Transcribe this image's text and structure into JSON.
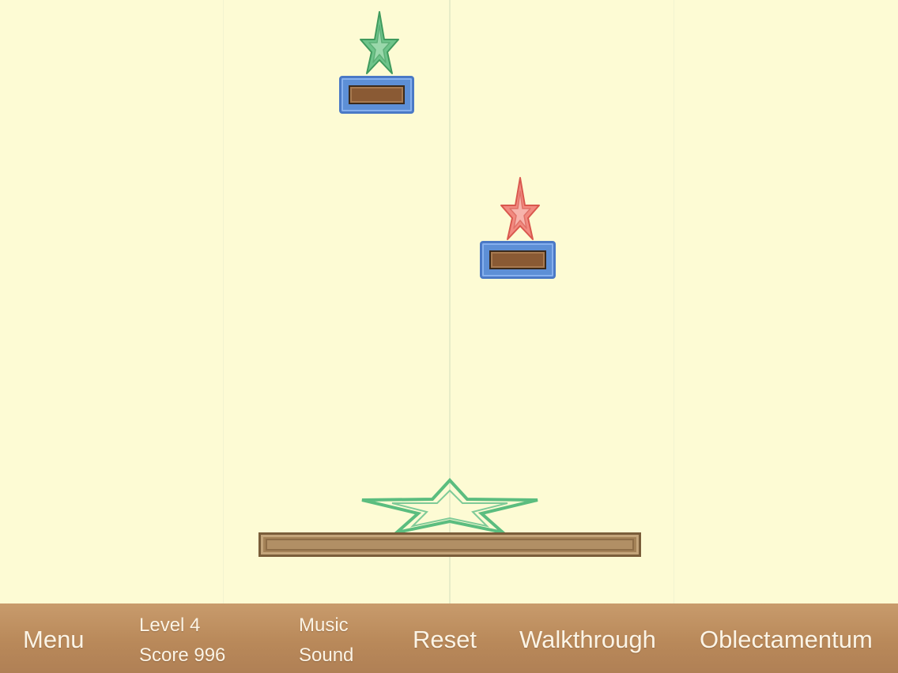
{
  "toolbar": {
    "menu_label": "Menu",
    "level_label": "Level 4",
    "score_label": "Score 996",
    "music_label": "Music",
    "sound_label": "Sound",
    "reset_label": "Reset",
    "walkthrough_label": "Walkthrough",
    "brand_label": "Oblectamentum"
  },
  "game": {
    "level": 4,
    "score": 996,
    "pieces": [
      {
        "kind": "star",
        "color": "green",
        "rests_on": "block-left"
      },
      {
        "kind": "star",
        "color": "red",
        "rests_on": "block-right"
      },
      {
        "kind": "goal-star-outline",
        "color": "green",
        "rests_on": "platform"
      }
    ]
  },
  "colors": {
    "background": "#fdfbd4",
    "block_frame": "#5d8fd6",
    "block_core": "#8a5a34",
    "star_green": "#5ec07e",
    "star_red": "#f07f76",
    "platform": "#a48257",
    "toolbar": "#b9895a",
    "toolbar_text": "#fbf4e6"
  }
}
